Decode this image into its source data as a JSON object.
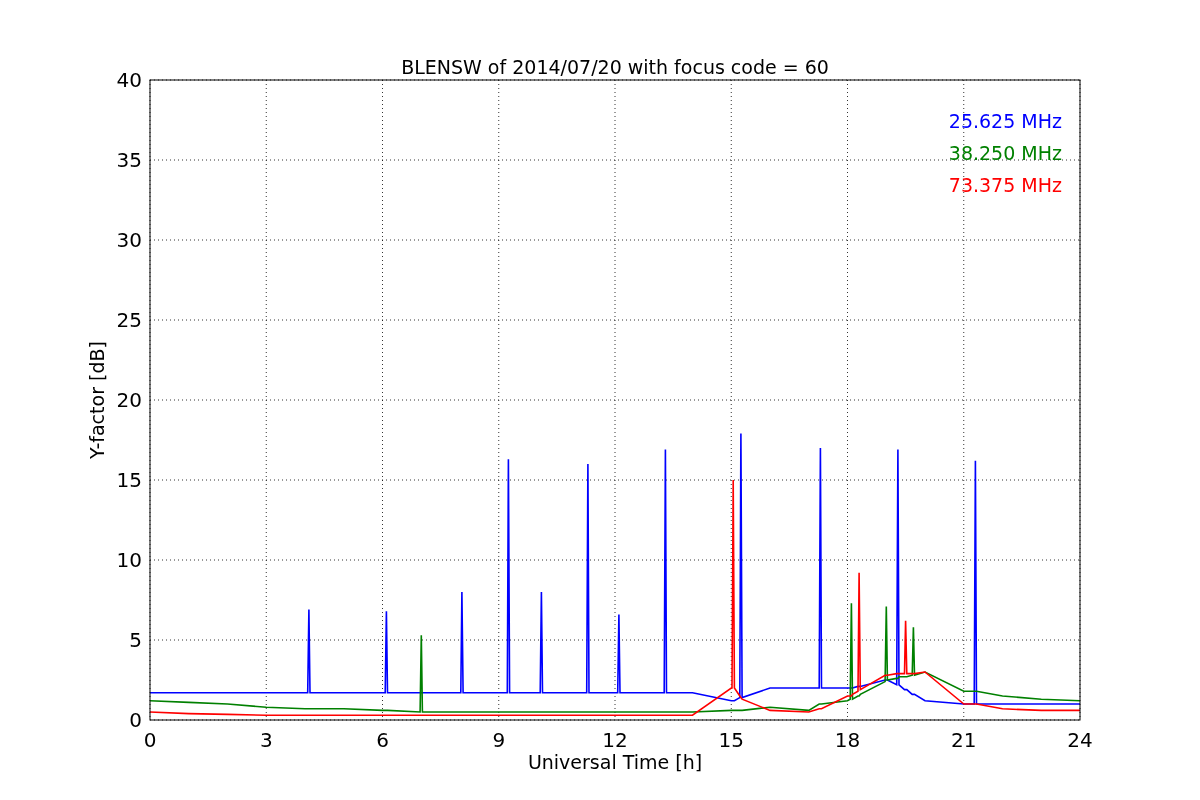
{
  "chart_data": {
    "type": "line",
    "title": "BLENSW of 2014/07/20 with focus code = 60",
    "xlabel": "Universal Time [h]",
    "ylabel": "Y-factor [dB]",
    "grid": true,
    "xlim": [
      0,
      24
    ],
    "ylim": [
      0,
      40
    ],
    "xticks": [
      0,
      3,
      6,
      9,
      12,
      15,
      18,
      21,
      24
    ],
    "yticks": [
      0,
      5,
      10,
      15,
      20,
      25,
      30,
      35,
      40
    ],
    "x": [
      0,
      1,
      2,
      3,
      4,
      4.07,
      4.1,
      4.13,
      5,
      6,
      6.07,
      6.1,
      6.13,
      6.97,
      7,
      7.03,
      8,
      8.02,
      8.05,
      8.08,
      9,
      9.22,
      9.25,
      9.28,
      10,
      10.07,
      10.1,
      10.13,
      11,
      11.27,
      11.3,
      11.33,
      12,
      12.07,
      12.1,
      12.13,
      13,
      13.27,
      13.3,
      13.33,
      14,
      15,
      15.02,
      15.05,
      15.08,
      15.22,
      15.25,
      15.28,
      16,
      17,
      17.27,
      17.3,
      17.33,
      18,
      18.07,
      18.1,
      18.13,
      18.27,
      18.3,
      18.33,
      18.97,
      19,
      19.03,
      19.27,
      19.3,
      19.33,
      19.47,
      19.5,
      19.53,
      19.67,
      19.7,
      19.73,
      20,
      21,
      21.27,
      21.3,
      21.33,
      22,
      23,
      24
    ],
    "series": [
      {
        "name": "25.625 MHz",
        "color": "#0000ff",
        "values": [
          1.7,
          1.7,
          1.7,
          1.7,
          1.7,
          1.7,
          6.9,
          1.7,
          1.7,
          1.7,
          1.7,
          6.8,
          1.7,
          1.7,
          1.7,
          1.7,
          1.7,
          1.7,
          8.0,
          1.7,
          1.7,
          1.7,
          16.3,
          1.7,
          1.7,
          1.7,
          8.0,
          1.7,
          1.7,
          1.7,
          16.0,
          1.7,
          1.7,
          1.7,
          6.6,
          1.7,
          1.7,
          1.7,
          16.9,
          1.7,
          1.7,
          1.2,
          1.2,
          1.2,
          1.2,
          1.4,
          17.9,
          1.4,
          2.0,
          2.0,
          2.0,
          17.0,
          2.0,
          2.0,
          2.0,
          2.0,
          2.0,
          2.1,
          2.1,
          2.1,
          2.5,
          2.5,
          2.5,
          2.2,
          16.9,
          2.2,
          1.9,
          1.9,
          1.9,
          1.6,
          1.6,
          1.6,
          1.2,
          1.0,
          1.0,
          16.2,
          1.0,
          1.0,
          1.0,
          1.0
        ]
      },
      {
        "name": "38.250 MHz",
        "color": "#008000",
        "values": [
          1.2,
          1.1,
          1.0,
          0.8,
          0.7,
          0.7,
          0.7,
          0.7,
          0.7,
          0.6,
          0.6,
          0.6,
          0.6,
          0.5,
          5.3,
          0.5,
          0.5,
          0.5,
          0.5,
          0.5,
          0.5,
          0.5,
          0.5,
          0.5,
          0.5,
          0.5,
          0.5,
          0.5,
          0.5,
          0.5,
          0.5,
          0.5,
          0.5,
          0.5,
          0.5,
          0.5,
          0.5,
          0.5,
          0.5,
          0.5,
          0.5,
          0.6,
          0.6,
          0.6,
          0.6,
          0.6,
          0.6,
          0.6,
          0.8,
          0.6,
          1.0,
          1.0,
          1.0,
          1.2,
          1.3,
          7.3,
          1.3,
          1.5,
          1.5,
          1.6,
          2.4,
          7.1,
          2.5,
          2.6,
          2.6,
          2.7,
          2.7,
          2.7,
          2.7,
          2.8,
          5.8,
          2.8,
          3.0,
          1.8,
          1.8,
          1.8,
          1.8,
          1.5,
          1.3,
          1.2
        ]
      },
      {
        "name": "73.375 MHz",
        "color": "#ff0000",
        "values": [
          0.5,
          0.4,
          0.35,
          0.3,
          0.3,
          0.3,
          0.3,
          0.3,
          0.3,
          0.3,
          0.3,
          0.3,
          0.3,
          0.3,
          0.3,
          0.3,
          0.3,
          0.3,
          0.3,
          0.3,
          0.3,
          0.3,
          0.3,
          0.3,
          0.3,
          0.3,
          0.3,
          0.3,
          0.3,
          0.3,
          0.3,
          0.3,
          0.3,
          0.3,
          0.3,
          0.3,
          0.3,
          0.3,
          0.3,
          0.3,
          0.3,
          2.0,
          2.0,
          15.0,
          2.0,
          1.5,
          1.4,
          1.3,
          0.6,
          0.5,
          0.7,
          0.7,
          0.7,
          1.5,
          1.5,
          1.5,
          1.6,
          1.8,
          9.2,
          1.9,
          2.8,
          2.8,
          2.8,
          2.9,
          2.9,
          2.9,
          2.9,
          6.2,
          2.9,
          2.9,
          2.9,
          2.9,
          3.0,
          1.0,
          1.0,
          1.0,
          1.0,
          0.7,
          0.6,
          0.6
        ]
      }
    ]
  }
}
